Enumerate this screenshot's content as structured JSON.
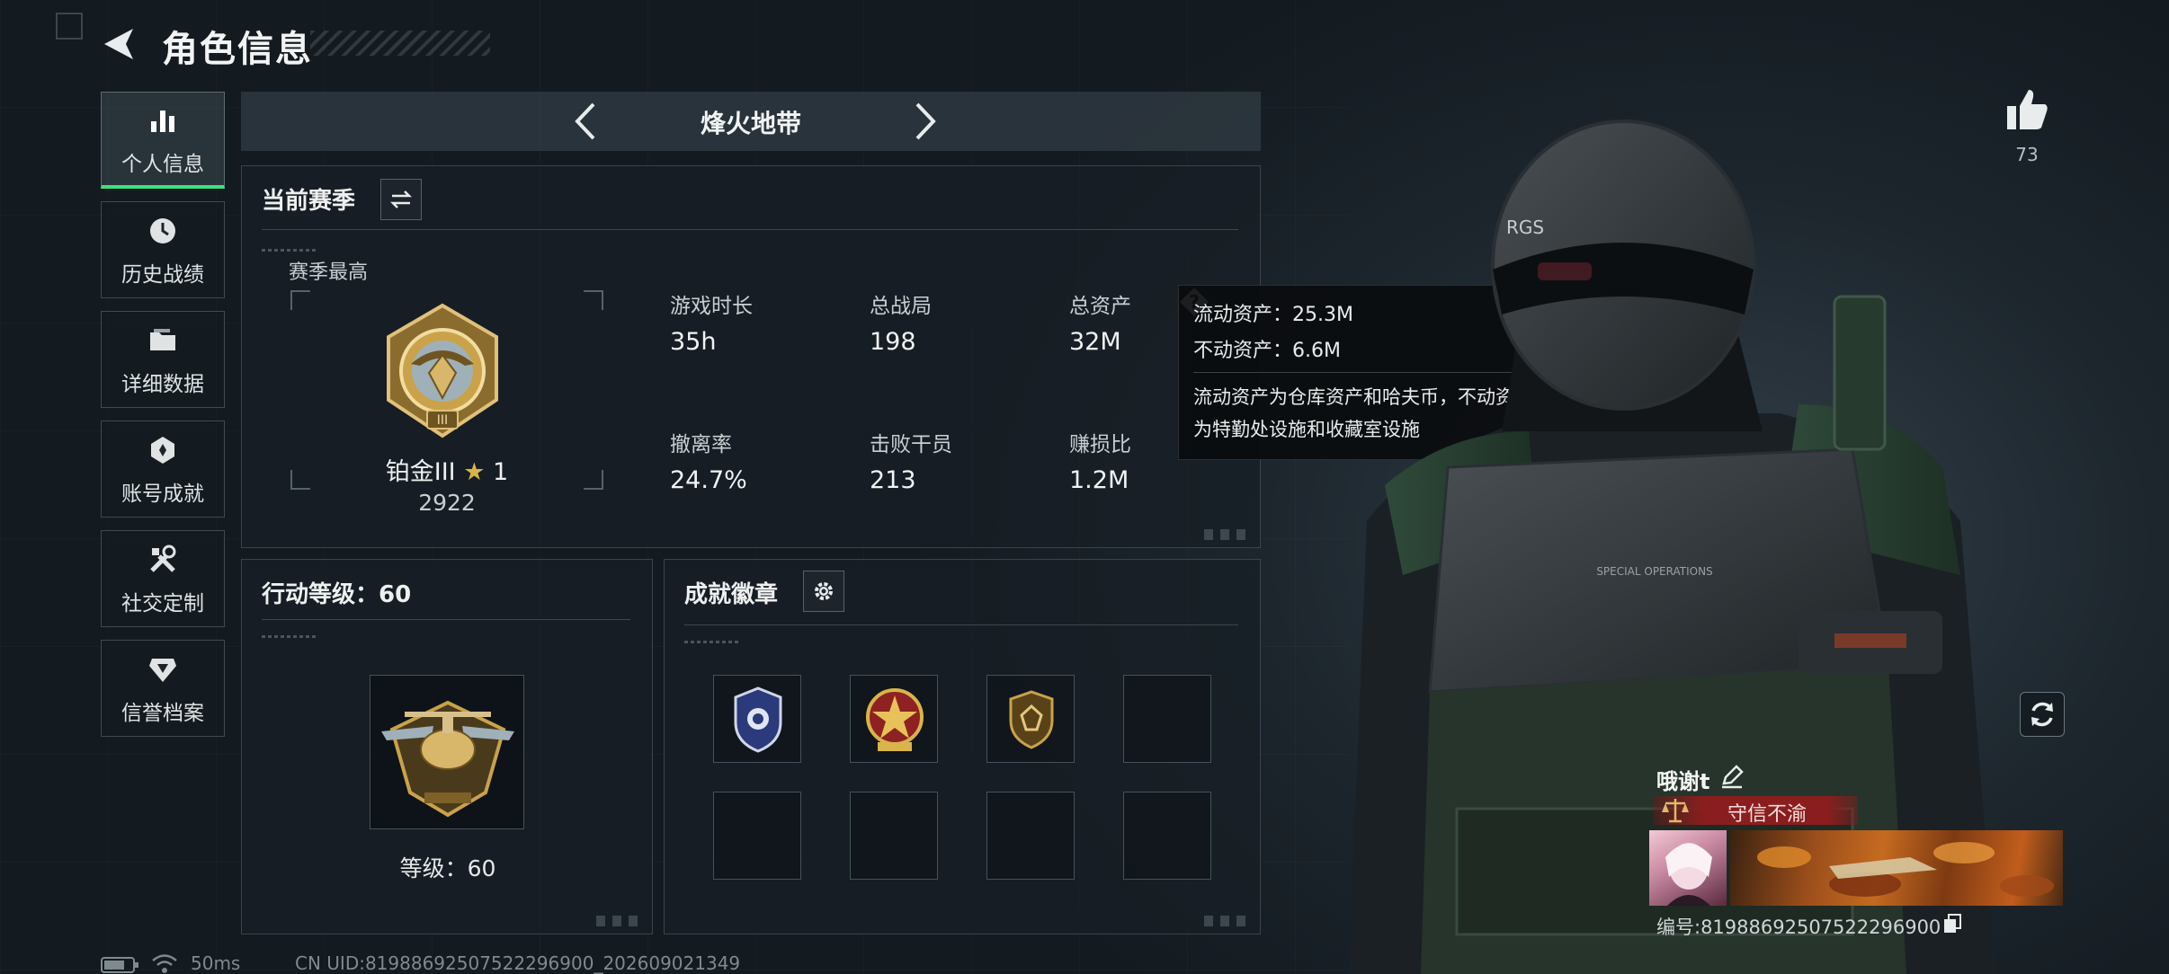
{
  "header": {
    "title": "角色信息"
  },
  "nav": {
    "items": [
      {
        "label": "个人信息",
        "icon": "bar-chart-icon",
        "active": true
      },
      {
        "label": "历史战绩",
        "icon": "history-clock-icon",
        "active": false
      },
      {
        "label": "详细数据",
        "icon": "folder-icon",
        "active": false
      },
      {
        "label": "账号成就",
        "icon": "achievement-badge-icon",
        "active": false
      },
      {
        "label": "社交定制",
        "icon": "tools-icon",
        "active": false
      },
      {
        "label": "信誉档案",
        "icon": "credit-shield-icon",
        "active": false
      }
    ]
  },
  "mode_selector": {
    "name": "烽火地带"
  },
  "season": {
    "title": "当前赛季",
    "best_label": "赛季最高",
    "rank_name": "铂金III",
    "rank_stars": "1",
    "rank_score": "2922",
    "stats": [
      {
        "label": "游戏时长",
        "value": "35h"
      },
      {
        "label": "总战局",
        "value": "198"
      },
      {
        "label": "总资产",
        "value": "32M"
      },
      {
        "label": "撤离率",
        "value": "24.7%"
      },
      {
        "label": "击败干员",
        "value": "213"
      },
      {
        "label": "赚损比",
        "value": "1.2M"
      }
    ],
    "help_glyph": "?"
  },
  "tooltip": {
    "line1": "流动资产：25.3M",
    "line2": "不动资产：6.6M",
    "desc1": "流动资产为仓库资产和哈夫币，不动资产",
    "desc2": "为特勤处设施和收藏室设施"
  },
  "action_level": {
    "title": "行动等级：60",
    "level_label": "等级：60"
  },
  "achievements": {
    "title": "成就徽章",
    "slots": [
      "police-badge",
      "star-medal",
      "gem-shield",
      "empty",
      "empty",
      "empty",
      "empty",
      "empty"
    ]
  },
  "profile": {
    "likes": "73",
    "name": "哦谢t",
    "credit_title": "守信不渝",
    "id_text": "编号:8198869250752229​6900"
  },
  "status_bar": {
    "latency": "50ms",
    "uid": "CN UID:81988692507522296900_202609021349"
  },
  "colors": {
    "accent_green": "#3ee07f",
    "credit_red": "#8a1e1e",
    "gold": "#c9a24a"
  }
}
